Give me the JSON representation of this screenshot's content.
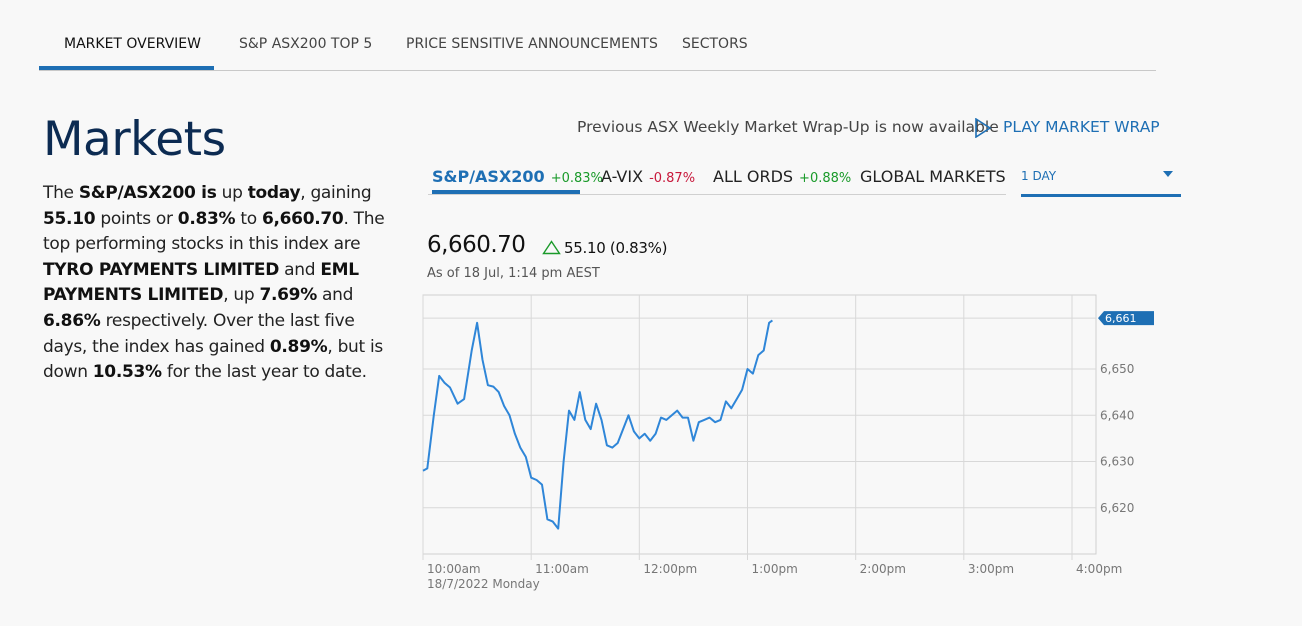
{
  "tabs": [
    {
      "label": "MARKET OVERVIEW",
      "active": true
    },
    {
      "label": "S&P ASX200 TOP 5",
      "active": false
    },
    {
      "label": "PRICE SENSITIVE ANNOUNCEMENTS",
      "active": false
    },
    {
      "label": "SECTORS",
      "active": false
    }
  ],
  "title": "Markets",
  "summary": {
    "t1": "The ",
    "b1": "S&P/ASX200 is",
    "t2": " up ",
    "b2": "today",
    "t3": ", gaining ",
    "b3": "55.10",
    "t4": " points or ",
    "b4": "0.83%",
    "t5": " to ",
    "b5": "6,660.70",
    "t6": ". The top performing stocks in this index are ",
    "b6": "TYRO PAYMENTS LIMITED",
    "t7": " and ",
    "b7": "EML PAYMENTS LIMITED",
    "t8": ", up ",
    "b8": "7.69%",
    "t9": " and ",
    "b9": "6.86%",
    "t10": " respectively. Over the last five days, the index has gained ",
    "b10": "0.89%",
    "t11": ", but is down ",
    "b11": "10.53%",
    "t12": " for the last year to date."
  },
  "wrap": {
    "text": "Previous ASX Weekly Market Wrap-Up is now available",
    "link": "PLAY MARKET WRAP",
    "icon": "play-icon"
  },
  "index_tabs": [
    {
      "name": "S&P/ASX200",
      "change": "+0.83%",
      "dir": "up",
      "active": true
    },
    {
      "name": "A-VIX",
      "change": "-0.87%",
      "dir": "down",
      "active": false
    },
    {
      "name": "ALL ORDS",
      "change": "+0.88%",
      "dir": "up",
      "active": false
    },
    {
      "name": "GLOBAL MARKETS",
      "change": "",
      "dir": "",
      "active": false
    }
  ],
  "period": {
    "selected": "1 DAY"
  },
  "price": {
    "value": "6,660.70",
    "change": "55.10 (0.83%)",
    "as_of": "As of 18 Jul, 1:14 pm AEST",
    "icon": "triangle-up-icon"
  },
  "colors": {
    "accent": "#1e6fb4",
    "up": "#1a9a2a",
    "down": "#c8193c",
    "line": "#2f86d8"
  },
  "chart_data": {
    "type": "line",
    "x_labels": [
      "10:00am",
      "11:00am",
      "12:00pm",
      "1:00pm",
      "2:00pm",
      "3:00pm",
      "4:00pm"
    ],
    "x_sublabel": "18/7/2022 Monday",
    "y_ticks": [
      "6,620",
      "6,630",
      "6,640",
      "6,650"
    ],
    "y_tick_values": [
      6620,
      6630,
      6640,
      6650
    ],
    "ylim": [
      6610,
      6666
    ],
    "x_range_hours": [
      0,
      6
    ],
    "last_label": "6,661",
    "last_value": 6661,
    "grid": true,
    "series": [
      {
        "x": [
          0,
          0.04,
          0.1,
          0.15,
          0.2,
          0.25,
          0.32,
          0.38,
          0.45,
          0.5,
          0.55,
          0.6,
          0.65,
          0.7,
          0.75,
          0.8,
          0.85,
          0.9,
          0.95,
          1.0,
          1.05,
          1.1,
          1.15,
          1.2,
          1.25,
          1.3,
          1.35,
          1.4,
          1.45,
          1.5,
          1.55,
          1.6,
          1.65,
          1.7,
          1.75,
          1.8,
          1.85,
          1.9,
          1.95,
          2.0,
          2.05,
          2.1,
          2.15,
          2.2,
          2.25,
          2.3,
          2.35,
          2.4,
          2.45,
          2.5,
          2.55,
          2.6,
          2.65,
          2.7,
          2.75,
          2.8,
          2.85,
          2.9,
          2.95,
          3.0,
          3.05,
          3.1,
          3.15,
          3.2,
          3.23
        ],
        "y": [
          6628,
          6628.5,
          6640,
          6648.5,
          6647,
          6646,
          6642.5,
          6643.5,
          6654,
          6660,
          6652,
          6646.5,
          6646.2,
          6645,
          6642,
          6640,
          6636,
          6633,
          6631,
          6626.5,
          6626,
          6625,
          6617.5,
          6617,
          6615.5,
          6630,
          6641,
          6639,
          6645,
          6639,
          6637,
          6642.5,
          6639,
          6633.5,
          6633,
          6634,
          6637,
          6640,
          6636.5,
          6635,
          6636,
          6634.5,
          6636,
          6639.5,
          6639,
          6640,
          6641,
          6639.5,
          6639.5,
          6634.5,
          6638.5,
          6639,
          6639.5,
          6638.5,
          6639,
          6643,
          6641.5,
          6643.5,
          6645.5,
          6650,
          6649,
          6653,
          6654,
          6660,
          6660.5
        ]
      }
    ]
  }
}
